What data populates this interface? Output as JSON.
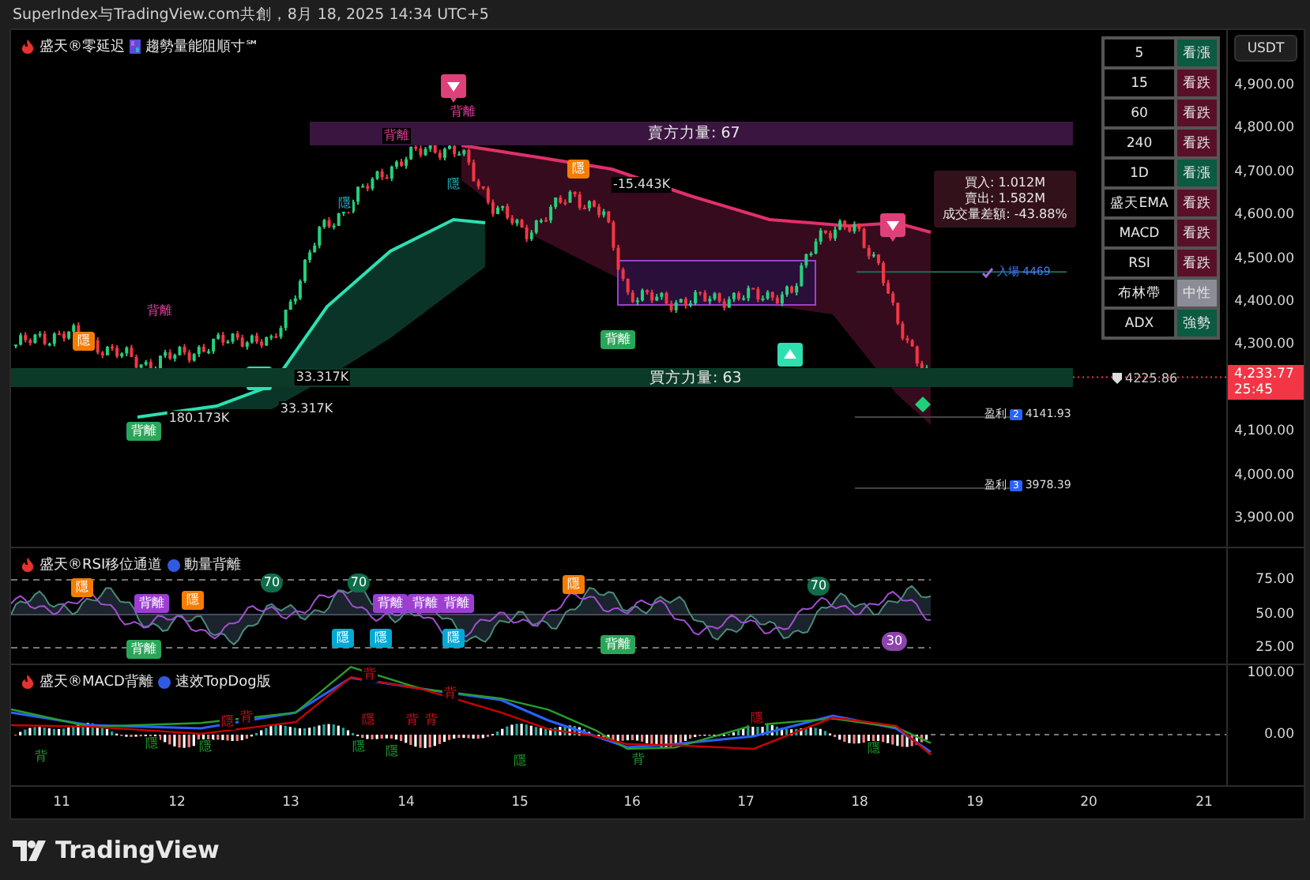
{
  "header": {
    "text": "SuperIndex与TradingView.com共創，8月 18, 2025 14:34 UTC+5"
  },
  "main_pane": {
    "title": "盛天®零延迟",
    "subtitle": "趨勢量能阻順寸℠",
    "banners": [
      {
        "text": "賣方力量: 67",
        "kind": "sell"
      },
      {
        "text": "買方力量: 63",
        "kind": "buy"
      }
    ],
    "volume_box": [
      "買入: 1.012M",
      "賣出: 1.582M",
      "成交量差額: -43.88%"
    ],
    "entry": {
      "label": "入場",
      "value": "4469"
    },
    "targets": [
      {
        "label": "盈利",
        "badge": "2",
        "value": "4141.93"
      },
      {
        "label": "盈利",
        "badge": "3",
        "value": "3978.39"
      }
    ],
    "last_marker": "4225.86",
    "labels": [
      {
        "text": "隱",
        "kind": "orange"
      },
      {
        "text": "背離",
        "kind": "pink"
      },
      {
        "text": "背離",
        "kind": "green"
      },
      {
        "text": "隱",
        "kind": "teal"
      },
      {
        "text": "背離",
        "kind": "pink"
      },
      {
        "text": "背離",
        "kind": "pink"
      },
      {
        "text": "隱",
        "kind": "teal"
      },
      {
        "text": "隱",
        "kind": "orange"
      },
      {
        "text": "背離",
        "kind": "green"
      },
      {
        "text": "-15.443K",
        "kind": "white"
      },
      {
        "text": "33.317K",
        "kind": "white"
      },
      {
        "text": "33.317K",
        "kind": "white"
      },
      {
        "text": "180.173K",
        "kind": "white"
      }
    ],
    "signal_table": [
      {
        "label": "5",
        "signal": "看漲",
        "kind": "bull"
      },
      {
        "label": "15",
        "signal": "看跌",
        "kind": "bear"
      },
      {
        "label": "60",
        "signal": "看跌",
        "kind": "bear"
      },
      {
        "label": "240",
        "signal": "看跌",
        "kind": "bear"
      },
      {
        "label": "1D",
        "signal": "看漲",
        "kind": "bull"
      },
      {
        "label": "盛天EMA",
        "signal": "看跌",
        "kind": "bear"
      },
      {
        "label": "MACD",
        "signal": "看跌",
        "kind": "bear"
      },
      {
        "label": "RSI",
        "signal": "看跌",
        "kind": "bear"
      },
      {
        "label": "布林帶",
        "signal": "中性",
        "kind": "neutral"
      },
      {
        "label": "ADX",
        "signal": "強勢",
        "kind": "bull"
      }
    ],
    "axis": {
      "unit": "USDT",
      "ticks": [
        "4,900.00",
        "4,800.00",
        "4,700.00",
        "4,600.00",
        "4,500.00",
        "4,400.00",
        "4,300.00",
        "4,100.00",
        "4,000.00",
        "3,900.00"
      ]
    },
    "price_tag": {
      "price": "4,233.77",
      "countdown": "25:45"
    }
  },
  "rsi_pane": {
    "title": "盛天®RSI移位通道",
    "subtitle": "動量背離",
    "ticks": [
      "75.00",
      "50.00",
      "25.00"
    ],
    "labels": [
      {
        "text": "隱",
        "kind": "orange"
      },
      {
        "text": "背離",
        "kind": "purple"
      },
      {
        "text": "隱",
        "kind": "orange"
      },
      {
        "text": "70",
        "kind": "circle"
      },
      {
        "text": "70",
        "kind": "circle"
      },
      {
        "text": "背離",
        "kind": "purple"
      },
      {
        "text": "背離",
        "kind": "purple"
      },
      {
        "text": "背離",
        "kind": "purple"
      },
      {
        "text": "隱",
        "kind": "cyan"
      },
      {
        "text": "隱",
        "kind": "cyan"
      },
      {
        "text": "隱",
        "kind": "cyan"
      },
      {
        "text": "背離",
        "kind": "green"
      },
      {
        "text": "隱",
        "kind": "orange"
      },
      {
        "text": "70",
        "kind": "circle"
      },
      {
        "text": "背離",
        "kind": "green"
      },
      {
        "text": "30",
        "kind": "violet"
      }
    ]
  },
  "macd_pane": {
    "title": "盛天®MACD背離",
    "subtitle": "速效TopDog版",
    "ticks": [
      "100.00",
      "0.00"
    ],
    "labels": [
      {
        "text": "背",
        "kind": "bear"
      },
      {
        "text": "背",
        "kind": "bear"
      },
      {
        "text": "隱",
        "kind": "bear"
      },
      {
        "text": "背",
        "kind": "bear"
      },
      {
        "text": "隱",
        "kind": "bear"
      },
      {
        "text": "背",
        "kind": "bear"
      },
      {
        "text": "背",
        "kind": "bear"
      },
      {
        "text": "隱",
        "kind": "bear"
      },
      {
        "text": "背",
        "kind": "bull"
      },
      {
        "text": "隱",
        "kind": "bull"
      },
      {
        "text": "隱",
        "kind": "bull"
      },
      {
        "text": "隱",
        "kind": "bull"
      },
      {
        "text": "隱",
        "kind": "bull"
      },
      {
        "text": "隱",
        "kind": "bull"
      },
      {
        "text": "背",
        "kind": "bull"
      },
      {
        "text": "隱",
        "kind": "bull"
      }
    ]
  },
  "time_axis": [
    "11",
    "12",
    "13",
    "14",
    "15",
    "16",
    "17",
    "18",
    "19",
    "20",
    "21"
  ],
  "footer": {
    "brand": "TradingView"
  }
}
